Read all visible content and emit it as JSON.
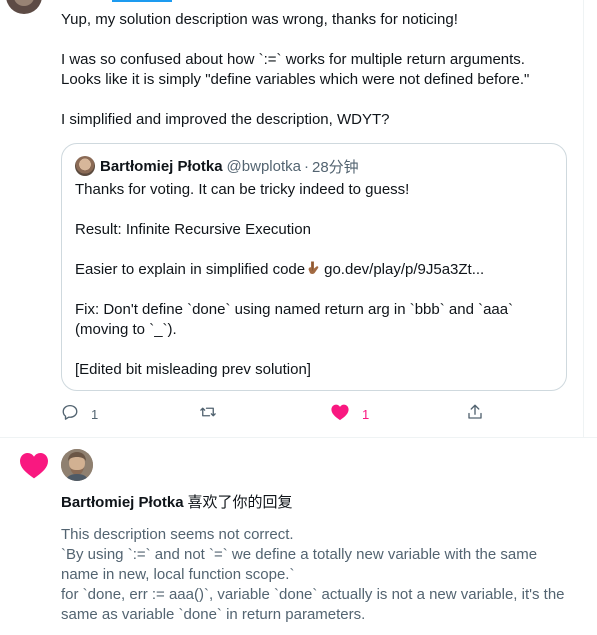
{
  "reply": {
    "lines": [
      "Yup, my solution description was wrong, thanks for noticing!",
      "I was so confused about how `:=` works for multiple return arguments.",
      "Looks like it is simply \"define variables which were not defined before.\"",
      "I simplified and improved the description, WDYT?"
    ]
  },
  "quote": {
    "name": "Bartłomiej Płotka",
    "handle": "@bwplotka",
    "time": "28分钟",
    "lines": [
      "Thanks for voting. It can be tricky indeed to guess!",
      "Result: Infinite Recursive Execution",
      "Easier to explain in simplified code",
      "go.dev/play/p/9J5a3Zt...",
      "Fix: Don't define `done` using named return arg in `bbb` and `aaa`",
      "(moving to `_`).",
      "[Edited bit misleading prev solution]"
    ]
  },
  "actions": {
    "reply_count": "1",
    "like_count": "1"
  },
  "notification": {
    "name": "Bartłomiej Płotka",
    "action": "喜欢了你的回复",
    "lines": [
      "This description seems not correct.",
      "`By using `:=` and not `=` we define a totally new variable with the same",
      "name in new, local function scope.`",
      "for `done, err := aaa()`, variable `done` actually is not a new variable, it's the",
      "same as variable `done` in return parameters."
    ]
  },
  "colors": {
    "like": "#f91880",
    "secondary_text": "#536471",
    "link": "#1d9bf0",
    "border": "#cfd9de"
  }
}
